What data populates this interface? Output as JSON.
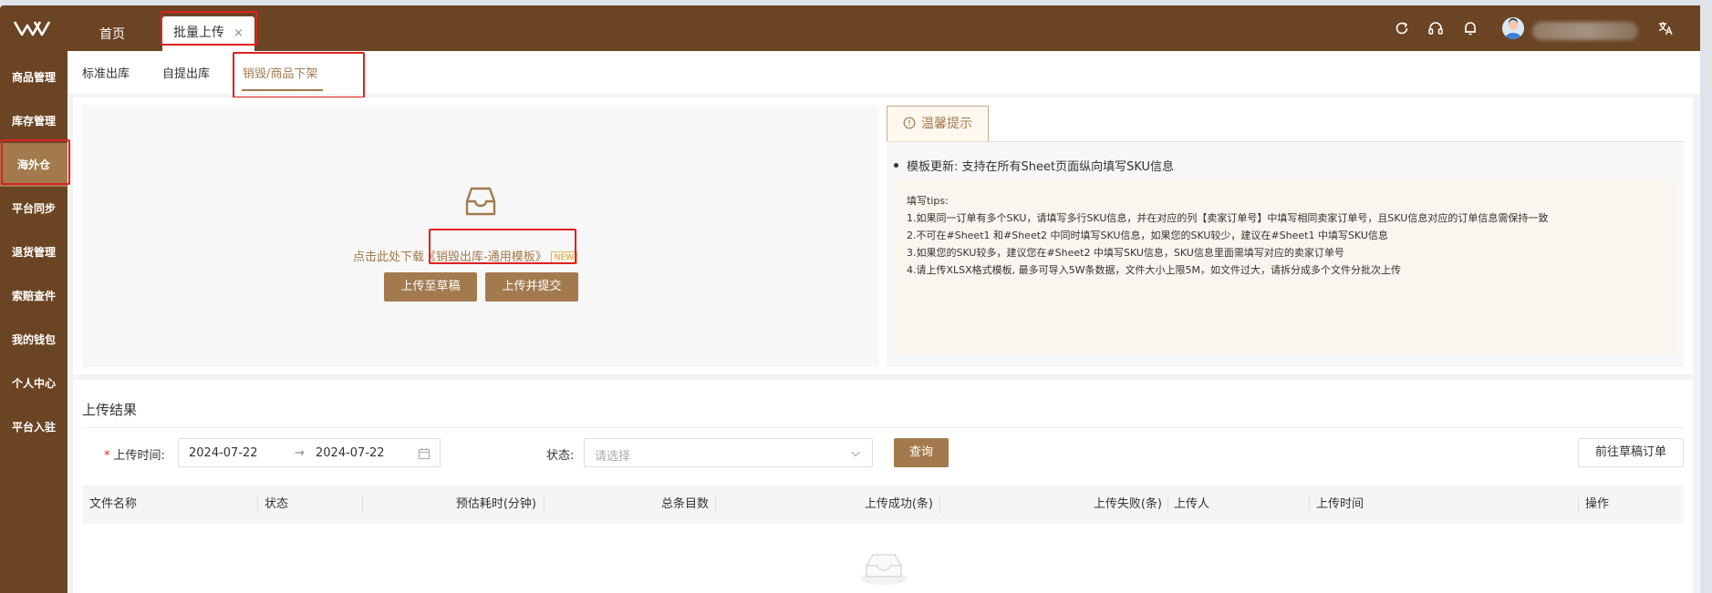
{
  "topbar": {
    "home_tab": "首页",
    "active_tab": "批量上传",
    "close_glyph": "×",
    "icons": [
      "refresh-icon",
      "headset-icon",
      "bell-icon",
      "user-avatar",
      "translate-icon"
    ]
  },
  "sidebar": {
    "items": [
      {
        "label": "商品管理"
      },
      {
        "label": "库存管理"
      },
      {
        "label": "海外仓",
        "active": true
      },
      {
        "label": "平台同步"
      },
      {
        "label": "退货管理"
      },
      {
        "label": "索赔查件"
      },
      {
        "label": "我的钱包"
      },
      {
        "label": "个人中心"
      },
      {
        "label": "平台入驻"
      }
    ]
  },
  "subnav": {
    "tabs": [
      {
        "label": "标准出库"
      },
      {
        "label": "自提出库"
      },
      {
        "label": "销毁/商品下架",
        "active": true
      }
    ]
  },
  "upload": {
    "download_prefix": "点击此处下载",
    "template_link": "《销毁出库-通用模板》",
    "new_badge": "NEW",
    "draft_button": "上传至草稿",
    "submit_button": "上传并提交"
  },
  "tips": {
    "tab_label": "温馨提示",
    "update_note": "模板更新: 支持在所有Sheet页面纵向填写SKU信息",
    "title": "填写tips:",
    "lines": [
      "1.如果同一订单有多个SKU，请填写多行SKU信息，并在对应的列【卖家订单号】中填写相同卖家订单号，且SKU信息对应的订单信息需保持一致",
      "2.不可在#Sheet1 和#Sheet2 中同时填写SKU信息，如果您的SKU较少，建议在#Sheet1 中填写SKU信息",
      "3.如果您的SKU较多，建议您在#Sheet2 中填写SKU信息，SKU信息里面需填写对应的卖家订单号",
      "4.请上传XLSX格式模板, 最多可导入5W条数据，文件大小上限5M，如文件过大，请拆分成多个文件分批次上传"
    ]
  },
  "results": {
    "title": "上传结果",
    "upload_time_label": "上传时间:",
    "required_mark": "*",
    "date_start": "2024-07-22",
    "date_arrow": "→",
    "date_end": "2024-07-22",
    "status_label": "状态:",
    "status_placeholder": "请选择",
    "query_button": "查询",
    "draft_orders_button": "前往草稿订单",
    "columns": [
      "文件名称",
      "状态",
      "预估耗时(分钟)",
      "总条目数",
      "上传成功(条)",
      "上传失败(条)",
      "上传人",
      "上传时间",
      "操作"
    ]
  },
  "colors": {
    "brand_dark": "#6b4423",
    "brand_accent": "#a27a4e",
    "highlight_red": "#e02020"
  }
}
